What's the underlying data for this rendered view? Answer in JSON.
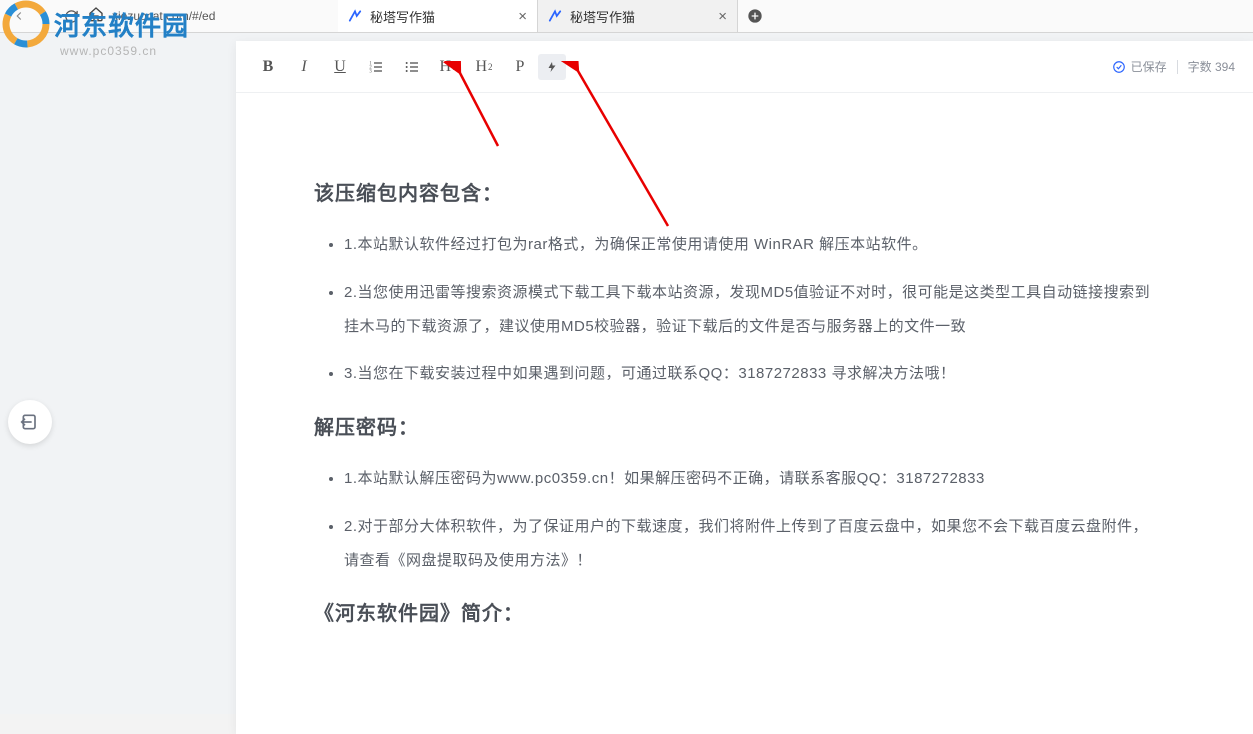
{
  "browser": {
    "url": "xiezuocat.com/#/ed",
    "tabs": [
      {
        "title": "秘塔写作猫",
        "active": true
      },
      {
        "title": "秘塔写作猫",
        "active": false
      }
    ]
  },
  "watermark": {
    "brand": "河东软件园",
    "url": "www.pc0359.cn"
  },
  "toolbar": {
    "bold_label": "B",
    "italic_label": "I",
    "underline_label": "U",
    "h1_label": "H",
    "h1_sub": "1",
    "h2_label": "H",
    "h2_sub": "2",
    "p_label": "P"
  },
  "status": {
    "saved_label": "已保存",
    "wordcount_label": "字数 394"
  },
  "document": {
    "h_contents": "该压缩包内容包含：",
    "contents_items": [
      "1.本站默认软件经过打包为rar格式，为确保正常使用请使用 WinRAR 解压本站软件。",
      "2.当您使用迅雷等搜索资源模式下载工具下载本站资源，发现MD5值验证不对时，很可能是这类型工具自动链接搜索到挂木马的下载资源了，建议使用MD5校验器，验证下载后的文件是否与服务器上的文件一致",
      "3.当您在下载安装过程中如果遇到问题，可通过联系QQ：3187272833 寻求解决方法哦！"
    ],
    "h_password": "解压密码：",
    "password_items": [
      "1.本站默认解压密码为www.pc0359.cn！如果解压密码不正确，请联系客服QQ：3187272833",
      "2.对于部分大体积软件，为了保证用户的下载速度，我们将附件上传到了百度云盘中，如果您不会下载百度云盘附件，请查看《网盘提取码及使用方法》！"
    ],
    "h_intro": "《河东软件园》简介："
  }
}
